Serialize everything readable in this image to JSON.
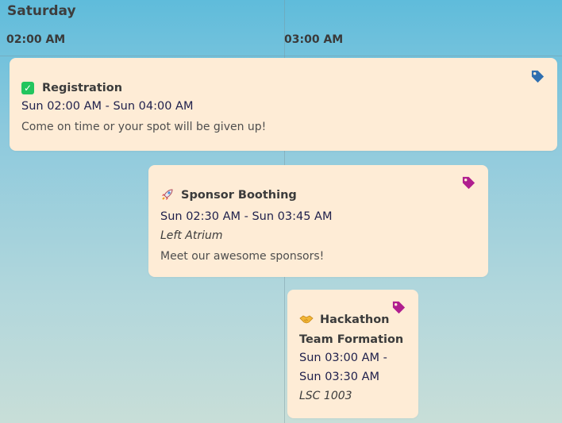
{
  "day": "Saturday",
  "time_labels": [
    "02:00 AM",
    "03:00 AM"
  ],
  "events": [
    {
      "title": "Registration",
      "icon": "check-emoji",
      "time": "Sun 02:00 AM - Sun 04:00 AM",
      "description": "Come on time or your spot will be given up!",
      "tag_color": "#2f6fb0"
    },
    {
      "title": "Sponsor Boothing",
      "icon": "rocket-emoji",
      "time": "Sun 02:30 AM - Sun 03:45 AM",
      "location": "Left Atrium",
      "description": "Meet our awesome sponsors!",
      "tag_color": "#b01e8f"
    },
    {
      "title_line1": "Hackathon",
      "title_line2": "Team Formation",
      "icon": "handshake-emoji",
      "time_line1": "Sun 03:00 AM -",
      "time_line2": "Sun 03:30 AM",
      "location": "LSC 1003",
      "tag_color": "#b01e8f"
    }
  ]
}
